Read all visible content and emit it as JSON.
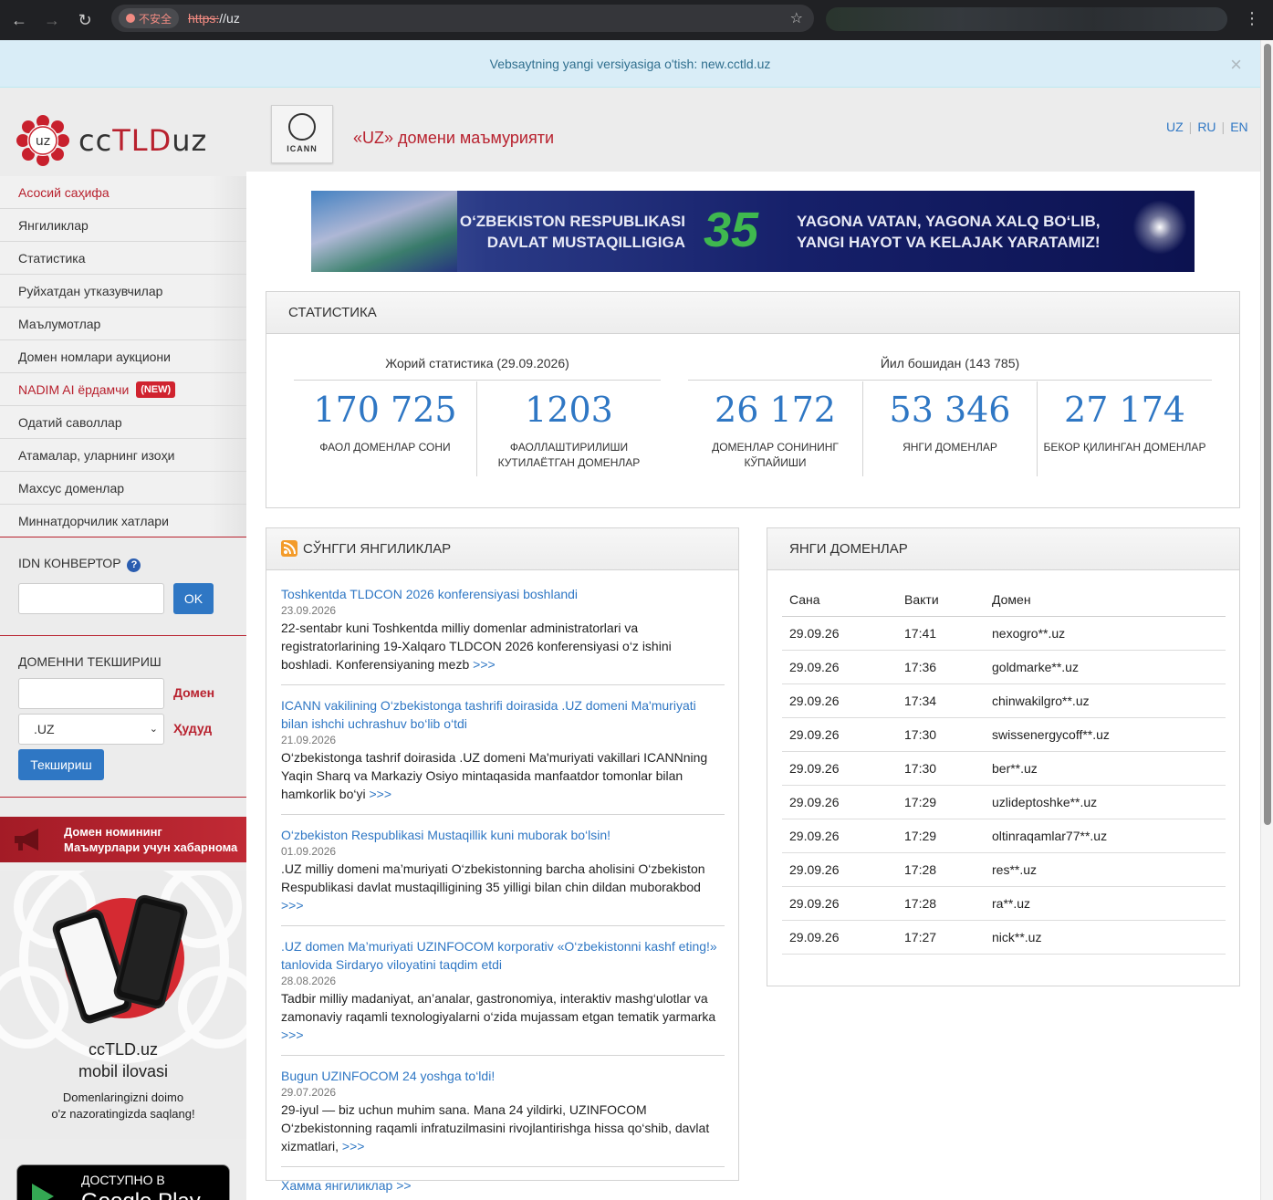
{
  "browser": {
    "security_label": "不安全",
    "url_scheme": "https:",
    "url_rest": "//uz"
  },
  "notice": {
    "text": "Vebsaytning yangi versiyasiga o'tish: new.cctld.uz",
    "close": "×"
  },
  "logo": {
    "mark_text": "uz",
    "prefix": "cc",
    "tld": "TLD",
    "suffix": "uz"
  },
  "header": {
    "icann_label": "ICANN",
    "title": "«UZ» домени маъмурияти",
    "langs": [
      "UZ",
      "RU",
      "EN"
    ]
  },
  "sidebar": {
    "items": [
      {
        "label": "Асосий саҳифа"
      },
      {
        "label": "Янгиликлар"
      },
      {
        "label": "Статистика"
      },
      {
        "label": "Руйхатдан утказувчилар"
      },
      {
        "label": "Маълумотлар"
      },
      {
        "label": "Домен номлари аукциони"
      },
      {
        "label": "NADIM AI ёрдамчи",
        "badge": "(NEW)"
      },
      {
        "label": "Одатий саволлар"
      },
      {
        "label": "Атамалар, уларнинг изоҳи"
      },
      {
        "label": "Махсус доменлар"
      },
      {
        "label": "Миннатдорчилик хатлари"
      }
    ],
    "idn": {
      "title": "IDN КОНВЕРТОР",
      "help": "?",
      "button": "OK"
    },
    "check": {
      "title": "ДОМЕННИ ТЕКШИРИШ",
      "domain_label": "Домен",
      "zone_label": "Ҳудуд",
      "zone_value": ".UZ",
      "button": "Текшириш"
    },
    "notify": {
      "line1": "Домен номининг",
      "line2": "Маъмурлари учун хабарнома"
    },
    "promo": {
      "title1": "ccTLD.uz",
      "title2": "mobil ilovasi",
      "sub1": "Domenlaringizni doimo",
      "sub2": "o'z nazoratingizda saqlang!"
    },
    "gplay": {
      "line1": "ДОСТУПНО В",
      "line2": "Google Play"
    }
  },
  "banner": {
    "left_line1": "O‘ZBEKISTON RESPUBLIKASI",
    "left_line2": "DAVLAT MUSTAQILLIGIGA",
    "number": "35",
    "right_line1": "YAGONA VATAN, YAGONA XALQ BO‘LIB,",
    "right_line2": "YANGI HAYOT VA KELAJAK YARATAMIZ!"
  },
  "stats": {
    "title": "СТАТИСТИКА",
    "current_title": "Жорий статистика (29.09.2026)",
    "year_title": "Йил бошидан (143 785)",
    "items": [
      {
        "value": "170 725",
        "label1": "ФАОЛ ДОМЕНЛАР СОНИ",
        "label2": ""
      },
      {
        "value": "1203",
        "label1": "ФАОЛЛАШТИРИЛИШИ",
        "label2": "КУТИЛАЁТГАН ДОМЕНЛАР"
      },
      {
        "value": "26 172",
        "label1": "ДОМЕНЛАР СОНИНИНГ",
        "label2": "КЎПАЙИШИ"
      },
      {
        "value": "53 346",
        "label1": "ЯНГИ ДОМЕНЛАР",
        "label2": ""
      },
      {
        "value": "27 174",
        "label1": "БЕКОР ҚИЛИНГАН ДОМЕНЛАР",
        "label2": ""
      }
    ]
  },
  "news": {
    "title": "СЎНГГИ ЯНГИЛИКЛАР",
    "more": ">>>",
    "all": "Хамма янгиликлар >>",
    "items": [
      {
        "title": "Toshkentda TLDCON 2026 konferensiyasi boshlandi",
        "date": "23.09.2026",
        "text": "22-sentabr kuni Toshkentda milliy domenlar administratorlari va registratorlarining 19-Xalqaro TLDCON 2026 konferensiyasi o‘z ishini boshladi. Konferensiyaning mezb"
      },
      {
        "title": "ICANN vakilining O‘zbekistonga tashrifi doirasida .UZ domeni Ma'muriyati bilan ishchi uchrashuv bo‘lib o‘tdi",
        "date": "21.09.2026",
        "text": "O‘zbekistonga tashrif doirasida .UZ domeni Ma'muriyati vakillari ICANNning Yaqin Sharq va Markaziy Osiyo mintaqasida manfaatdor tomonlar bilan hamkorlik bo‘yi"
      },
      {
        "title": "O‘zbekiston Respublikasi Mustaqillik kuni muborak bo‘lsin!",
        "date": "01.09.2026",
        "text": ".UZ milliy domeni ma’muriyati O‘zbekistonning barcha aholisini O‘zbekiston Respublikasi davlat mustaqilligining 35 yilligi bilan chin dildan muborakbod"
      },
      {
        "title": ".UZ domen Ma’muriyati UZINFOCOM korporativ «O‘zbekistonni kashf eting!» tanlovida Sirdaryo viloyatini taqdim etdi",
        "date": "28.08.2026",
        "text": "Tadbir milliy madaniyat, an’analar, gastronomiya, interaktiv mashg‘ulotlar va zamonaviy raqamli texnologiyalarni o‘zida mujassam etgan tematik yarmarka"
      },
      {
        "title": "Bugun UZINFOCOM 24 yoshga to‘ldi!",
        "date": "29.07.2026",
        "text": "29-iyul — biz uchun muhim sana. Mana 24 yildirki, UZINFOCOM O‘zbekistonning raqamli infratuzilmasini rivojlantirishga hissa qo‘shib, davlat xizmatlari,"
      }
    ]
  },
  "domains": {
    "title": "ЯНГИ ДОМЕНЛАР",
    "headers": [
      "Сана",
      "Вакти",
      "Домен"
    ],
    "rows": [
      [
        "29.09.26",
        "17:41",
        "nexogro**.uz"
      ],
      [
        "29.09.26",
        "17:36",
        "goldmarke**.uz"
      ],
      [
        "29.09.26",
        "17:34",
        "chinwakilgro**.uz"
      ],
      [
        "29.09.26",
        "17:30",
        "swissenergycoff**.uz"
      ],
      [
        "29.09.26",
        "17:30",
        "ber**.uz"
      ],
      [
        "29.09.26",
        "17:29",
        "uzlideptoshke**.uz"
      ],
      [
        "29.09.26",
        "17:29",
        "oltinraqamlar77**.uz"
      ],
      [
        "29.09.26",
        "17:28",
        "res**.uz"
      ],
      [
        "29.09.26",
        "17:28",
        "ra**.uz"
      ],
      [
        "29.09.26",
        "17:27",
        "nick**.uz"
      ]
    ]
  }
}
